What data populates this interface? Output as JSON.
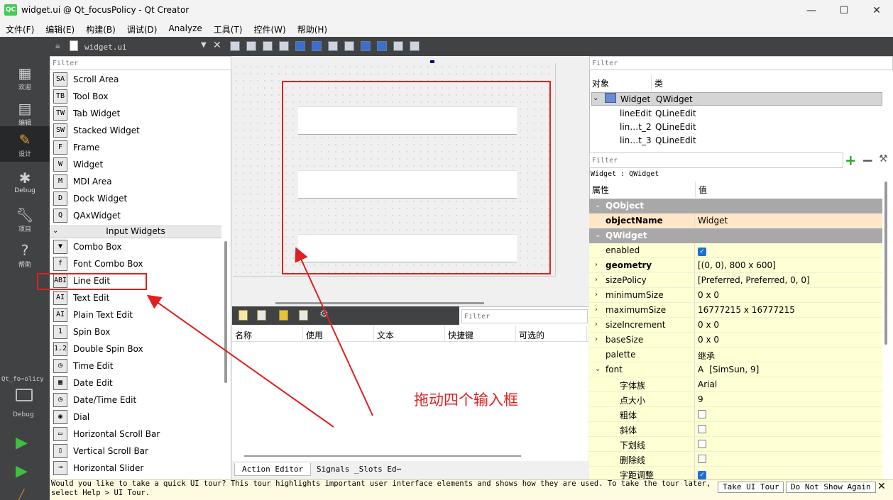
{
  "window": {
    "title": "widget.ui @ Qt_focusPolicy - Qt Creator",
    "logo": "QC",
    "controls": [
      "minimize-icon",
      "maximize-icon",
      "close-icon"
    ]
  },
  "menubar": [
    "文件(F)",
    "编辑(E)",
    "构建(B)",
    "调试(D)",
    "Analyze",
    "工具(T)",
    "控件(W)",
    "帮助(H)"
  ],
  "modebar": {
    "modes": [
      {
        "label": "欢迎",
        "icon": "grid-icon"
      },
      {
        "label": "编辑",
        "icon": "document-icon"
      },
      {
        "label": "设计",
        "icon": "pencil-icon",
        "active": true
      },
      {
        "label": "Debug",
        "icon": "bug-icon"
      },
      {
        "label": "项目",
        "icon": "wrench-icon"
      },
      {
        "label": "帮助",
        "icon": "help-icon"
      }
    ],
    "project_label": "Qt_fo⋯olicy",
    "project_mode": "Debug"
  },
  "editor_toolbar": {
    "file_name": "widget.ui"
  },
  "widget_box": {
    "filter_placeholder": "Filter",
    "items_top": [
      {
        "label": "Scroll Area",
        "icon": "SA"
      },
      {
        "label": "Tool Box",
        "icon": "TB"
      },
      {
        "label": "Tab Widget",
        "icon": "TW"
      },
      {
        "label": "Stacked Widget",
        "icon": "SW"
      },
      {
        "label": "Frame",
        "icon": "F"
      },
      {
        "label": "Widget",
        "icon": "W"
      },
      {
        "label": "MDI Area",
        "icon": "M"
      },
      {
        "label": "Dock Widget",
        "icon": "D"
      },
      {
        "label": "QAxWidget",
        "icon": "Q"
      }
    ],
    "category": "Input Widgets",
    "items_input": [
      {
        "label": "Combo Box",
        "icon": "▼"
      },
      {
        "label": "Font Combo Box",
        "icon": "f"
      },
      {
        "label": "Line Edit",
        "icon": "ABI"
      },
      {
        "label": "Text Edit",
        "icon": "AI"
      },
      {
        "label": "Plain Text Edit",
        "icon": "AI"
      },
      {
        "label": "Spin Box",
        "icon": "1"
      },
      {
        "label": "Double Spin Box",
        "icon": "1.2"
      },
      {
        "label": "Time Edit",
        "icon": "◷"
      },
      {
        "label": "Date Edit",
        "icon": "▦"
      },
      {
        "label": "Date/Time Edit",
        "icon": "◷"
      },
      {
        "label": "Dial",
        "icon": "◉"
      },
      {
        "label": "Horizontal Scroll Bar",
        "icon": "▭"
      },
      {
        "label": "Vertical Scroll Bar",
        "icon": "▯"
      },
      {
        "label": "Horizontal Slider",
        "icon": "╼"
      }
    ]
  },
  "action_editor": {
    "filter_placeholder": "Filter",
    "columns": [
      "名称",
      "使用",
      "文本",
      "快捷键",
      "可选的"
    ],
    "tabs": [
      "Action Editor",
      "Signals _Slots Ed⋯"
    ]
  },
  "object_inspector": {
    "filter_placeholder": "Filter",
    "columns": [
      "对象",
      "类"
    ],
    "rows": [
      {
        "object": "Widget",
        "class": "QWidget"
      },
      {
        "object": "lineEdit",
        "class": "QLineEdit"
      },
      {
        "object": "lin…t_2",
        "class": "QLineEdit"
      },
      {
        "object": "lin…t_3",
        "class": "QLineEdit"
      }
    ]
  },
  "property_editor": {
    "filter_placeholder": "Filter",
    "class_label": "Widget : QWidget",
    "columns": [
      "属性",
      "值"
    ],
    "rows": [
      {
        "name": "QObject",
        "value": "",
        "type": "section"
      },
      {
        "name": "objectName",
        "value": "Widget",
        "type": "org"
      },
      {
        "name": "QWidget",
        "value": "",
        "type": "section"
      },
      {
        "name": "enabled",
        "value": "",
        "type": "yel",
        "checkbox": true
      },
      {
        "name": "geometry",
        "value": "[(0, 0), 800 x 600]",
        "type": "yel",
        "expand": true,
        "bold": true
      },
      {
        "name": "sizePolicy",
        "value": "[Preferred, Preferred, 0, 0]",
        "type": "yel",
        "expand": true
      },
      {
        "name": "minimumSize",
        "value": "0 x 0",
        "type": "yel",
        "expand": true
      },
      {
        "name": "maximumSize",
        "value": "16777215 x 16777215",
        "type": "yel",
        "expand": true
      },
      {
        "name": "sizeIncrement",
        "value": "0 x 0",
        "type": "yel",
        "expand": true
      },
      {
        "name": "baseSize",
        "value": "0 x 0",
        "type": "yel",
        "expand": true
      },
      {
        "name": "palette",
        "value": "继承",
        "type": "yel"
      },
      {
        "name": "font",
        "value": "[SimSun, 9]",
        "type": "yel",
        "expanded": true,
        "font_icon": "A"
      },
      {
        "name": "字体族",
        "value": "Arial",
        "type": "yel",
        "sub": true
      },
      {
        "name": "点大小",
        "value": "9",
        "type": "yel",
        "sub": true
      },
      {
        "name": "粗体",
        "value": "",
        "type": "yel",
        "sub": true,
        "checkbox": false
      },
      {
        "name": "斜体",
        "value": "",
        "type": "yel",
        "sub": true,
        "checkbox": false
      },
      {
        "name": "下划线",
        "value": "",
        "type": "yel",
        "sub": true,
        "checkbox": false
      },
      {
        "name": "删除线",
        "value": "",
        "type": "yel",
        "sub": true,
        "checkbox": false
      },
      {
        "name": "字距调整",
        "value": "",
        "type": "yel",
        "sub": true,
        "checkbox": true
      }
    ]
  },
  "info_bar": {
    "text": "Would you like to take a quick UI tour? This tour highlights important user interface elements and shows how they are used. To take the tour later, select Help > UI Tour.",
    "take_tour": "Take UI Tour",
    "dont_show": "Do Not Show Again"
  },
  "annotation": {
    "text": "拖动四个输入框",
    "color": "#e02020"
  }
}
